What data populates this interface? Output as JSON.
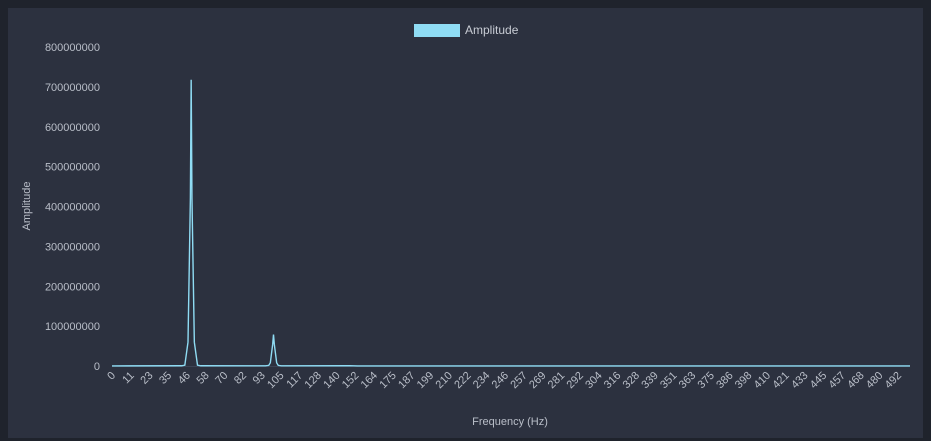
{
  "chart_data": {
    "type": "line",
    "xlabel": "Frequency (Hz)",
    "ylabel": "Amplitude",
    "ylim": [
      0,
      800000000
    ],
    "yticks": [
      "0",
      "100000000",
      "200000000",
      "300000000",
      "400000000",
      "500000000",
      "600000000",
      "700000000",
      "800000000"
    ],
    "xticks": [
      "0",
      "11",
      "23",
      "35",
      "46",
      "58",
      "70",
      "82",
      "93",
      "105",
      "117",
      "128",
      "140",
      "152",
      "164",
      "175",
      "187",
      "199",
      "210",
      "222",
      "234",
      "246",
      "257",
      "269",
      "281",
      "292",
      "304",
      "316",
      "328",
      "339",
      "351",
      "363",
      "375",
      "386",
      "398",
      "410",
      "421",
      "433",
      "445",
      "457",
      "468",
      "480",
      "492"
    ],
    "xlim": [
      0,
      504
    ],
    "legend_position": "top-center",
    "grid": false,
    "series": [
      {
        "name": "Amplitude",
        "color": "#8fdcf4",
        "points": [
          [
            0,
            200000
          ],
          [
            44,
            600000
          ],
          [
            46,
            2000000
          ],
          [
            48,
            60000000
          ],
          [
            49.5,
            420000000
          ],
          [
            50,
            718000000
          ],
          [
            50.5,
            420000000
          ],
          [
            52,
            60000000
          ],
          [
            54,
            2000000
          ],
          [
            56,
            600000
          ],
          [
            97,
            500000
          ],
          [
            99,
            1500000
          ],
          [
            100,
            8000000
          ],
          [
            101.5,
            55000000
          ],
          [
            102,
            79000000
          ],
          [
            102.5,
            55000000
          ],
          [
            104,
            8000000
          ],
          [
            105,
            1500000
          ],
          [
            107,
            500000
          ],
          [
            150,
            900000
          ],
          [
            155,
            200000
          ],
          [
            300,
            150000
          ],
          [
            504,
            100000
          ]
        ]
      }
    ]
  }
}
